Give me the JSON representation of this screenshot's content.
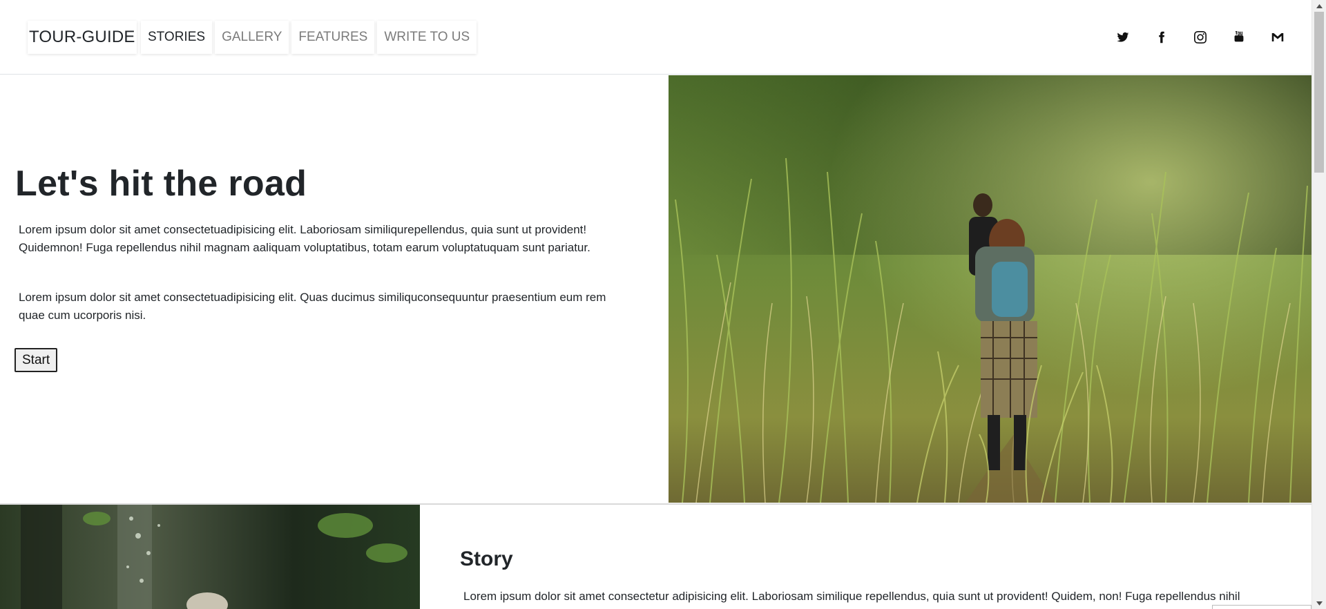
{
  "header": {
    "brand": "TOUR-GUIDE",
    "nav": [
      {
        "label": "STORIES",
        "active": true
      },
      {
        "label": "GALLERY",
        "active": false
      },
      {
        "label": "FEATURES",
        "active": false
      },
      {
        "label": "WRITE TO US",
        "active": false
      }
    ],
    "social_icons": [
      "twitter-icon",
      "facebook-icon",
      "instagram-icon",
      "youtube-icon",
      "gmail-icon"
    ]
  },
  "hero": {
    "title": "Let's hit the road",
    "paragraph1_line1": "Lorem ipsum dolor sit amet consectetuadipisicing elit. Laboriosam similiqurepellendus, quia sunt ut provident!",
    "paragraph1_line2": "Quidemnon! Fuga repellendus nihil magnam aaliquam voluptatibus, totam earum voluptatuquam sunt pariatur.",
    "paragraph2_line1": "Lorem ipsum dolor sit amet consectetuadipisicing elit. Quas ducimus similiquconsequuntur praesentium eum rem",
    "paragraph2_line2": "quae cum ucorporis nisi.",
    "button_label": "Start",
    "image": "hikers-in-tall-grass-photo"
  },
  "story": {
    "title": "Story",
    "paragraph": "Lorem ipsum dolor sit amet consectetur adipisicing elit. Laboriosam similique repellendus, quia sunt ut provident! Quidem, non! Fuga repellendus nihil",
    "image": "forest-photo"
  },
  "colors": {
    "text": "#212529",
    "nav_inactive": "#7b7b7b",
    "divider": "#dee2e6"
  }
}
